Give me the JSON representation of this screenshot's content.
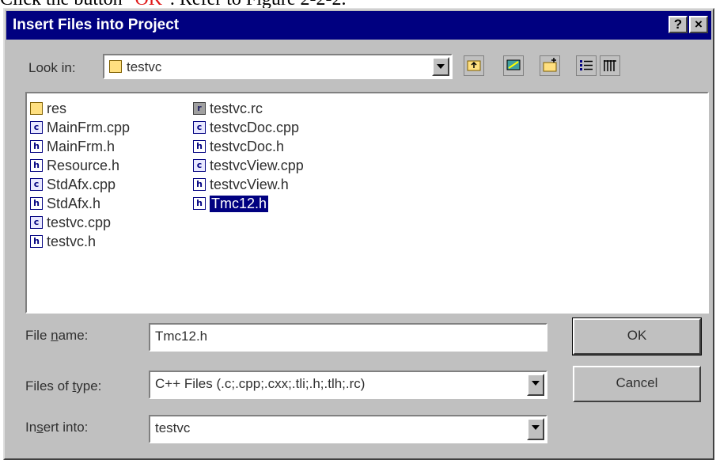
{
  "caption": {
    "prefix": "Click the button \"",
    "highlight": "OK",
    "suffix": "\". Refer to Figure 2-2-2."
  },
  "dialog": {
    "title": "Insert Files into Project",
    "help_label": "?",
    "close_label": "×"
  },
  "look_in": {
    "label": "Look in:",
    "value": "testvc",
    "toolbar": [
      "up-one-level-icon",
      "desktop-icon",
      "new-folder-icon",
      "list-view-icon",
      "details-view-icon"
    ]
  },
  "files": {
    "column1": [
      {
        "name": "res",
        "icon": "folder-icon"
      },
      {
        "name": "MainFrm.cpp",
        "icon": "cpp-file-icon"
      },
      {
        "name": "MainFrm.h",
        "icon": "header-file-icon"
      },
      {
        "name": "Resource.h",
        "icon": "header-file-icon"
      },
      {
        "name": "StdAfx.cpp",
        "icon": "cpp-file-icon"
      },
      {
        "name": "StdAfx.h",
        "icon": "header-file-icon"
      },
      {
        "name": "testvc.cpp",
        "icon": "cpp-file-icon"
      },
      {
        "name": "testvc.h",
        "icon": "header-file-icon"
      }
    ],
    "column2": [
      {
        "name": "testvc.rc",
        "icon": "resource-file-icon"
      },
      {
        "name": "testvcDoc.cpp",
        "icon": "cpp-file-icon"
      },
      {
        "name": "testvcDoc.h",
        "icon": "header-file-icon"
      },
      {
        "name": "testvcView.cpp",
        "icon": "cpp-file-icon"
      },
      {
        "name": "testvcView.h",
        "icon": "header-file-icon"
      },
      {
        "name": "Tmc12.h",
        "icon": "header-file-icon",
        "selected": true
      }
    ]
  },
  "file_name": {
    "label": "File name:",
    "value": "Tmc12.h"
  },
  "files_of_type": {
    "label": "Files of type:",
    "value": "C++ Files (.c;.cpp;.cxx;.tli;.h;.tlh;.rc)"
  },
  "insert_into": {
    "label": "Insert into:",
    "value": "testvc"
  },
  "buttons": {
    "ok": "OK",
    "cancel": "Cancel"
  }
}
